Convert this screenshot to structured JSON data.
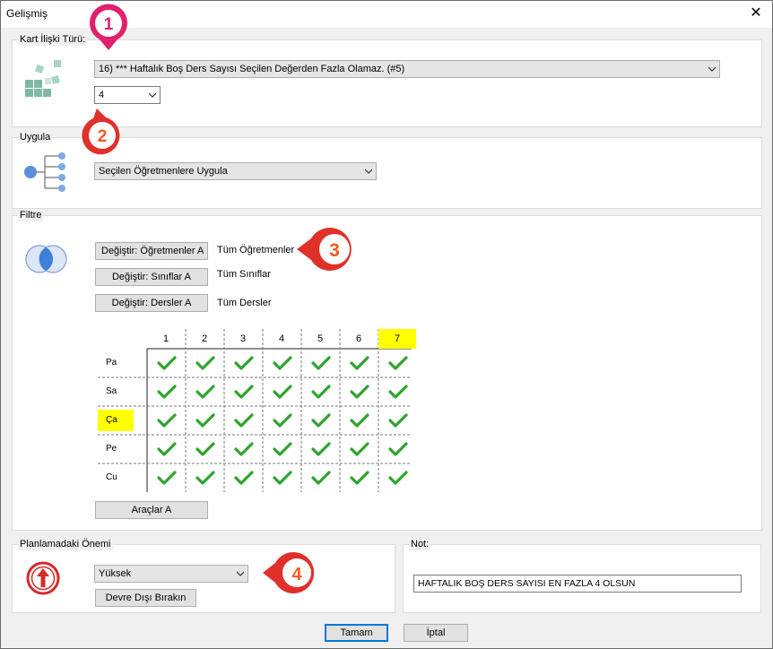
{
  "window": {
    "title": "Gelişmiş",
    "close_glyph": "✕"
  },
  "relation": {
    "label": "Kart İlişki Türü:",
    "selected": "16) *** Haftalık Boş Ders Sayısı Seçilen Değerden Fazla Olamaz. (#5)",
    "value": "4",
    "icon": "blocks-icon"
  },
  "apply": {
    "label": "Uygula",
    "selected": "Seçilen Öğretmenlere Uygula",
    "icon": "tree-icon"
  },
  "filter": {
    "label": "Filtre",
    "icon": "venn-icon",
    "rows": [
      {
        "button": "Değiştir: Öğretmenler A",
        "value": "Tüm Öğretmenler"
      },
      {
        "button": "Değiştir: Sınıflar A",
        "value": "Tüm Sınıflar"
      },
      {
        "button": "Değiştir: Dersler A",
        "value": "Tüm Dersler"
      }
    ],
    "grid": {
      "columns": [
        "1",
        "2",
        "3",
        "4",
        "5",
        "6",
        "7"
      ],
      "days": [
        "Pa",
        "Sa",
        "Ça",
        "Pe",
        "Cu"
      ],
      "highlight_column": "7",
      "highlight_day": "Ça",
      "highlight_color": "#ffff00",
      "check_color": "#2ea42e"
    },
    "tools_button": "Araçlar A"
  },
  "importance": {
    "label": "Planlamadaki Önemi",
    "selected": "Yüksek",
    "disable_button": "Devre Dışı Bırakın",
    "icon": "up-arrow-icon",
    "icon_color": "#d62b2b"
  },
  "note": {
    "label": "Not:",
    "value": "HAFTALIK BOŞ DERS SAYISI EN FAZLA 4 OLSUN"
  },
  "footer": {
    "ok": "Tamam",
    "cancel": "İptal"
  },
  "callouts": [
    {
      "number": "1",
      "color": "#e0216c"
    },
    {
      "number": "2",
      "color": "#f15a22"
    },
    {
      "number": "3",
      "color": "#f15a22"
    },
    {
      "number": "4",
      "color": "#f15a22"
    }
  ]
}
